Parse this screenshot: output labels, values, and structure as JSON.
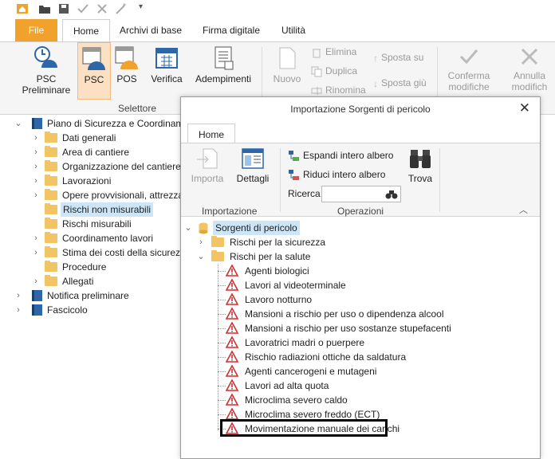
{
  "menu": {
    "file": "File",
    "home": "Home",
    "archivi": "Archivi di base",
    "firma": "Firma digitale",
    "utilita": "Utilità"
  },
  "ribbon": {
    "psc_preliminare": [
      "PSC",
      "Preliminare"
    ],
    "psc": "PSC",
    "pos": "POS",
    "verifica": "Verifica",
    "adempimenti": "Adempimenti",
    "selettore": "Selettore",
    "nuovo": "Nuovo",
    "elimina": "Elimina",
    "duplica": "Duplica",
    "rinomina": "Rinomina",
    "sposta_su": "Sposta su",
    "sposta_giu": "Sposta giù",
    "conferma": [
      "Conferma",
      "modifiche"
    ],
    "annulla": [
      "Annulla",
      "modifich"
    ]
  },
  "tree": {
    "root": "Piano di Sicurezza e Coordinamento",
    "items": [
      "Dati generali",
      "Area di cantiere",
      "Organizzazione del cantiere",
      "Lavorazioni",
      "Opere provvisionali, attrezzature",
      "Rischi non misurabili",
      "Rischi misurabili",
      "Coordinamento lavori",
      "Stima dei costi della sicurezza",
      "Procedure",
      "Allegati"
    ],
    "notifica": "Notifica preliminare",
    "fascicolo": "Fascicolo"
  },
  "dialog": {
    "title": "Importazione Sorgenti di pericolo",
    "tab_home": "Home",
    "importa": "Importa",
    "dettagli": "Dettagli",
    "group_importazione": "Importazione",
    "espandi": "Espandi intero albero",
    "riduci": "Riduci intero albero",
    "ricerca": "Ricerca",
    "ricerca_value": "",
    "trova": "Trova",
    "group_operazioni": "Operazioni",
    "root": "Sorgenti di pericolo",
    "sicurezza": "Rischi per la sicurezza",
    "salute": "Rischi per la salute",
    "items": [
      "Agenti biologici",
      "Lavori al videoterminale",
      "Lavoro notturno",
      "Mansioni a rischio per uso o dipendenza alcool",
      "Mansioni a rischio per uso sostanze stupefacenti",
      "Lavoratrici madri o puerpere",
      "Rischio radiazioni ottiche da saldatura",
      "Agenti cancerogeni e mutageni",
      "Lavori ad alta quota",
      "Microclima severo caldo",
      "Microclima severo freddo (ECT)",
      "Movimentazione manuale dei carichi"
    ]
  },
  "colors": {
    "accent": "#f0a22c",
    "selection": "#cde6f7",
    "folder": "#f3c464",
    "book": "#2e67a8"
  }
}
